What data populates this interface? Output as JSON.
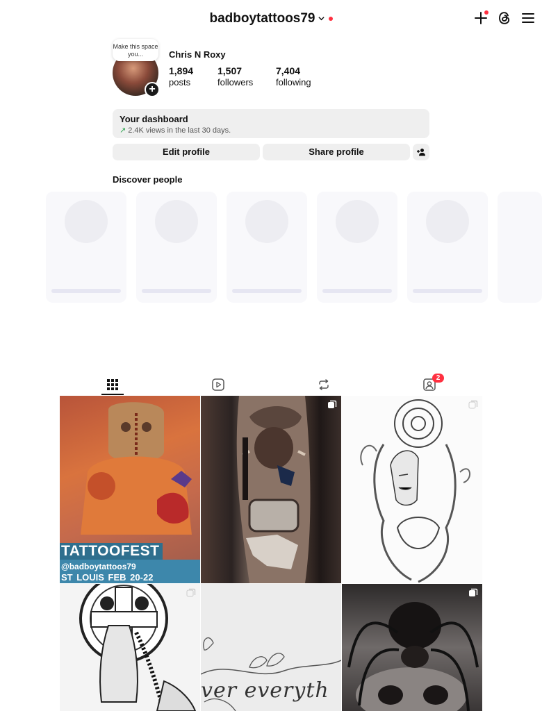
{
  "header": {
    "username": "badboytattoos79",
    "icons": {
      "create": "plus-icon",
      "threads": "threads-icon",
      "menu": "hamburger-menu-icon",
      "dropdown": "chevron-down-icon"
    },
    "notification_color": "#ff3040"
  },
  "profile": {
    "note": "Make this space you...",
    "display_name": "Chris N Roxy",
    "stats": [
      {
        "value": "1,894",
        "label": "posts"
      },
      {
        "value": "1,507",
        "label": "followers"
      },
      {
        "value": "7,404",
        "label": "following"
      }
    ]
  },
  "dashboard": {
    "title": "Your dashboard",
    "subtitle": "2.4K views in the last 30 days."
  },
  "actions": {
    "edit_label": "Edit profile",
    "share_label": "Share profile"
  },
  "discover": {
    "title": "Discover people"
  },
  "tabs": {
    "items": [
      "grid-icon",
      "reels-icon",
      "reposts-icon",
      "tagged-icon"
    ],
    "tagged_badge": "2"
  },
  "posts": [
    {
      "name": "tattoo-fest-post",
      "banner_title": "TATTOOFEST",
      "banner_handle": "@badboytattoos79",
      "banner_city": "ST LOUIS    FEB 20-22"
    },
    {
      "name": "texas-tattoo-post"
    },
    {
      "name": "rose-woman-tattoo-post"
    },
    {
      "name": "praying-hands-tattoo-post"
    },
    {
      "name": "script-tattoo-post",
      "script": "ver everyth"
    },
    {
      "name": "spider-skull-tattoo-post"
    }
  ],
  "colors": {
    "accent_red": "#ff3040",
    "button_bg": "#efefef",
    "trend_green": "#2ca44e"
  }
}
